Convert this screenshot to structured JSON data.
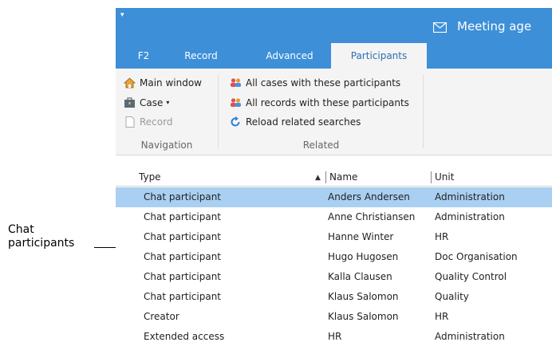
{
  "annotation": {
    "line1": "Chat",
    "line2": "participants"
  },
  "titlebar": {
    "title": "Meeting age"
  },
  "tabs": [
    {
      "label": "F2"
    },
    {
      "label": "Record"
    },
    {
      "label": "Advanced"
    },
    {
      "label": "Participants"
    }
  ],
  "ribbon": {
    "navigation": {
      "main_window": "Main window",
      "case": "Case",
      "record": "Record",
      "group_label": "Navigation"
    },
    "related": {
      "all_cases": "All cases with these participants",
      "all_records": "All records with these participants",
      "reload": "Reload related searches",
      "group_label": "Related"
    }
  },
  "list": {
    "columns": {
      "type": "Type",
      "name": "Name",
      "unit": "Unit"
    },
    "rows": [
      {
        "type": "Chat participant",
        "name": "Anders Andersen",
        "unit": "Administration"
      },
      {
        "type": "Chat participant",
        "name": "Anne Christiansen",
        "unit": "Administration"
      },
      {
        "type": "Chat participant",
        "name": "Hanne Winter",
        "unit": "HR"
      },
      {
        "type": "Chat participant",
        "name": "Hugo Hugosen",
        "unit": "Doc Organisation"
      },
      {
        "type": "Chat participant",
        "name": "Kalla Clausen",
        "unit": "Quality Control"
      },
      {
        "type": "Chat participant",
        "name": "Klaus Salomon",
        "unit": "Quality"
      },
      {
        "type": "Creator",
        "name": "Klaus Salomon",
        "unit": "HR"
      },
      {
        "type": "Extended access",
        "name": "HR",
        "unit": "Administration"
      }
    ]
  },
  "colors": {
    "accent": "#3d8fd8",
    "selected_row": "#a9d0f2"
  }
}
